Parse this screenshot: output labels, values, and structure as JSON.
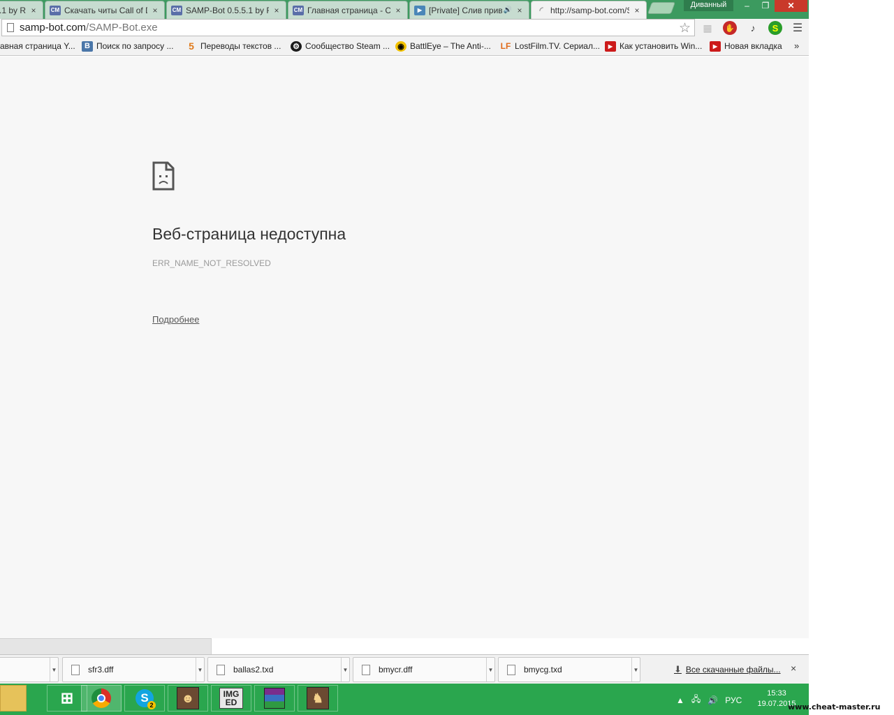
{
  "tabs": [
    {
      "title": ".1 by R",
      "favicon": "",
      "close": "×"
    },
    {
      "title": "Скачать читы Call of D",
      "favicon": "CM",
      "close": "×"
    },
    {
      "title": "SAMP-Bot 0.5.5.1 by R",
      "favicon": "CM",
      "close": "×"
    },
    {
      "title": "Главная страница - C",
      "favicon": "CM",
      "close": "×"
    },
    {
      "title": "[Private] Слив прив",
      "favicon": "▶",
      "audio": "🔊",
      "close": "×"
    },
    {
      "title": "http://samp-bot.com/S",
      "favicon": "loading-spinner-icon",
      "close": "×"
    }
  ],
  "profile_label": "Диванный",
  "window_controls": {
    "minimize": "–",
    "maximize": "❐",
    "close": "✕"
  },
  "omnibox": {
    "host": "samp-bot.com",
    "path": "/SAMP-Bot.exe"
  },
  "toolbar_icons": [
    "star-icon",
    "ghost-extension-icon",
    "adblock-icon",
    "music-extension-icon",
    "s-extension-icon",
    "menu-icon"
  ],
  "bookmarks": [
    {
      "label": "авная страница Y...",
      "icon": ""
    },
    {
      "label": "Поиск по запросу ...",
      "icon": "B"
    },
    {
      "label": "Переводы текстов ...",
      "icon": "5"
    },
    {
      "label": "Сообщество Steam ...",
      "icon": "steam"
    },
    {
      "label": "BattlEye – The Anti-...",
      "icon": "eye"
    },
    {
      "label": "LostFilm.TV. Сериал...",
      "icon": "LF"
    },
    {
      "label": "Как установить Win...",
      "icon": "▶"
    },
    {
      "label": "Новая вкладка",
      "icon": "▶"
    }
  ],
  "bookmarks_overflow": "»",
  "error": {
    "title": "Веб-страница недоступна",
    "code": "ERR_NAME_NOT_RESOLVED",
    "details_link": "Подробнее"
  },
  "downloads": [
    {
      "name": ""
    },
    {
      "name": "sfr3.dff"
    },
    {
      "name": "ballas2.txd"
    },
    {
      "name": "bmycr.dff"
    },
    {
      "name": "bmycg.txd"
    }
  ],
  "all_downloads_label": "Все скачанные файлы...",
  "shelf_close": "×",
  "taskbar": {
    "apps": [
      "file-explorer",
      "windows-store",
      "chrome",
      "skype",
      "gta-san-andreas",
      "img-editor",
      "winrar",
      "gta-character"
    ],
    "skype_badge": "2",
    "imged_label_top": "IMG",
    "imged_label_bottom": "ED",
    "language": "РУС",
    "time": "15:33",
    "date": "19.07.2015"
  },
  "watermark": "www.cheat-master.ru",
  "colors": {
    "frame": "#3c9a5f",
    "taskbar": "#2aa64e",
    "close": "#c9392a"
  }
}
